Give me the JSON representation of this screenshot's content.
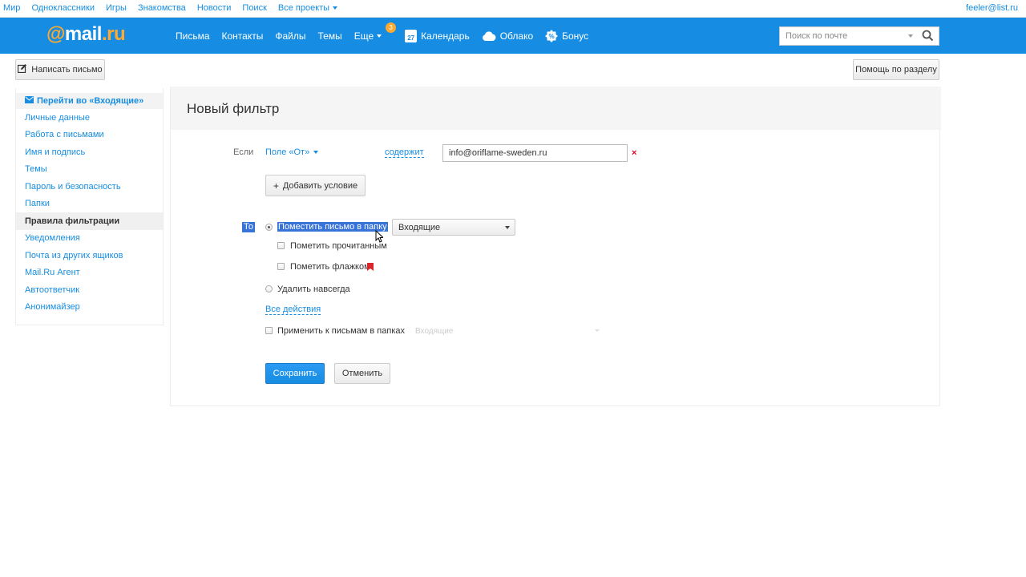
{
  "topbar": {
    "links": [
      "Мир",
      "Одноклассники",
      "Игры",
      "Знакомства",
      "Новости",
      "Поиск"
    ],
    "all_projects": "Все проекты",
    "user_email": "feeler@list.ru"
  },
  "header": {
    "logo_at": "@",
    "logo_mail": "mail",
    "logo_ru": ".ru",
    "nav": {
      "letters": "Письма",
      "contacts": "Контакты",
      "files": "Файлы",
      "themes": "Темы",
      "more": "Еще",
      "more_badge": "3",
      "calendar": "Календарь",
      "calendar_day": "27",
      "cloud": "Облако",
      "bonus": "Бонус"
    },
    "search_placeholder": "Поиск по почте"
  },
  "toolbar": {
    "compose_label": "Написать письмо",
    "help_label": "Помощь по разделу"
  },
  "sidebar": {
    "goto_inbox": "Перейти во «Входящие»",
    "items": [
      "Личные данные",
      "Работа с письмами",
      "Имя и подпись",
      "Темы",
      "Пароль и безопасность",
      "Папки",
      "Правила фильтрации",
      "Уведомления",
      "Почта из других ящиков",
      "Mail.Ru Агент",
      "Автоответчик",
      "Анонимайзер"
    ],
    "active_item": "Правила фильтрации"
  },
  "filter": {
    "title": "Новый фильтр",
    "if_label": "Если",
    "field_selector": "Поле «От»",
    "operator": "содержит",
    "value": "info@oriflame-sweden.ru",
    "remove_symbol": "×",
    "add_condition": "Добавить условие",
    "then_label": "То",
    "move_to_folder": "Поместить письмо в папку",
    "folder_selected": "Входящие",
    "mark_read": "Пометить прочитанным",
    "mark_flag": "Пометить флажком",
    "delete_forever": "Удалить навсегда",
    "all_actions": "Все действия",
    "apply_to_folders": "Применить к письмам в папках",
    "apply_folder_value": "Входящие",
    "save_label": "Сохранить",
    "cancel_label": "Отменить"
  },
  "colors": {
    "brand_blue": "#168de2",
    "logo_orange": "#ffa930",
    "selection_blue": "#3874d8",
    "flag_red": "#d9252b"
  },
  "icons": [
    "chevron-down-icon",
    "calendar-icon",
    "cloud-icon",
    "bonus-icon",
    "search-icon",
    "pencil-icon",
    "envelope-icon",
    "plus-icon",
    "close-icon",
    "flag-icon",
    "cursor-icon"
  ]
}
